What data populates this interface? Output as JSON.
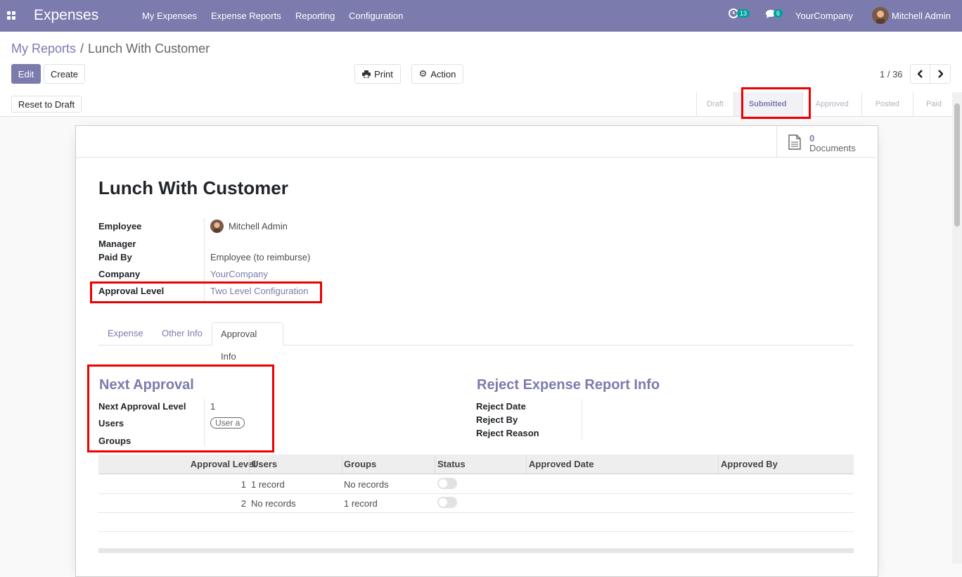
{
  "nav": {
    "app_title": "Expenses",
    "menu": [
      "My Expenses",
      "Expense Reports",
      "Reporting",
      "Configuration"
    ],
    "activity_count": "13",
    "message_count": "6",
    "company": "YourCompany",
    "user": "Mitchell Admin"
  },
  "breadcrumb": {
    "parent": "My Reports",
    "separator": "/",
    "current": "Lunch With Customer"
  },
  "buttons": {
    "edit": "Edit",
    "create": "Create",
    "print": "Print",
    "action": "Action",
    "reset": "Reset to Draft"
  },
  "pager": {
    "text": "1 / 36"
  },
  "stages": [
    "Draft",
    "Submitted",
    "Approved",
    "Posted",
    "Paid"
  ],
  "active_stage": "Submitted",
  "documents": {
    "count": "0",
    "label": "Documents"
  },
  "record": {
    "title": "Lunch With Customer",
    "fields": {
      "employee_label": "Employee",
      "employee": "Mitchell Admin",
      "manager_label": "Manager",
      "manager": "",
      "paid_by_label": "Paid By",
      "paid_by": "Employee (to reimburse)",
      "company_label": "Company",
      "company": "YourCompany",
      "approval_level_label": "Approval Level",
      "approval_level": "Two Level Configuration"
    }
  },
  "tabs": [
    "Expense",
    "Other Info",
    "Approval Info"
  ],
  "active_tab": "Approval Info",
  "next_approval": {
    "heading": "Next Approval",
    "level_label": "Next Approval Level",
    "level": "1",
    "users_label": "Users",
    "users_tag": "User a",
    "groups_label": "Groups"
  },
  "reject": {
    "heading": "Reject Expense Report Info",
    "date_label": "Reject Date",
    "by_label": "Reject By",
    "reason_label": "Reject Reason"
  },
  "table": {
    "headers": [
      "Approval Level",
      "Users",
      "Groups",
      "Status",
      "Approved Date",
      "Approved By"
    ],
    "rows": [
      {
        "level": "1",
        "users": "1 record",
        "groups": "No records",
        "status": false,
        "date": "",
        "by": ""
      },
      {
        "level": "2",
        "users": "No records",
        "groups": "1 record",
        "status": false,
        "date": "",
        "by": ""
      }
    ]
  },
  "colors": {
    "brand": "#7c7bad",
    "highlight": "#e00000",
    "badge": "#00a09d"
  }
}
